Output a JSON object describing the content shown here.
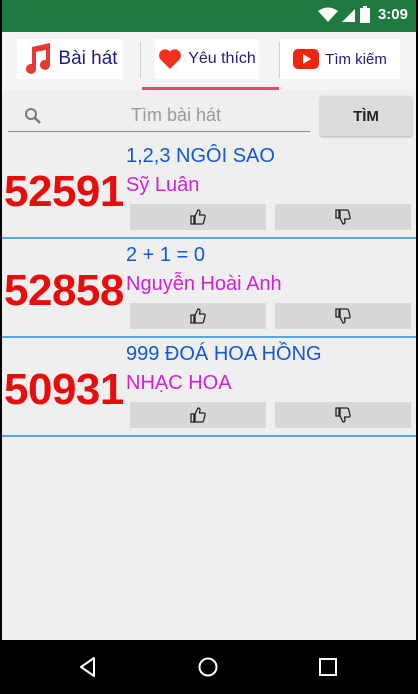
{
  "status_bar": {
    "time": "3:09",
    "icons": [
      "wifi-icon",
      "signal-icon",
      "battery-icon"
    ]
  },
  "tabs": [
    {
      "label": "Bài hát",
      "icon": "music-note-icon",
      "active": false
    },
    {
      "label": "Yêu thích",
      "icon": "heart-icon",
      "active": true
    },
    {
      "label": "Tìm kiếm",
      "icon": "youtube-play-icon",
      "active": false
    }
  ],
  "search": {
    "placeholder": "Tìm bài hát",
    "value": "",
    "button_label": "TÌM"
  },
  "songs": [
    {
      "code": "52591",
      "title": "1,2,3 NGÔI SAO",
      "artist": "Sỹ Luân"
    },
    {
      "code": "52858",
      "title": "2 + 1 = 0",
      "artist": "Nguyễn Hoài Anh"
    },
    {
      "code": "50931",
      "title": "999 ĐOÁ HOA HỒNG",
      "artist": "NHẠC HOA"
    }
  ],
  "colors": {
    "status_bar": "#1f7a3f",
    "tab_text": "#1b1b8a",
    "tab_indicator": "#e04a6e",
    "code": "#e80d0d",
    "title": "#1358d6",
    "artist": "#d51fd5",
    "divider": "#58a9e0"
  },
  "nav_bar": [
    "back-icon",
    "home-icon",
    "recents-icon"
  ]
}
